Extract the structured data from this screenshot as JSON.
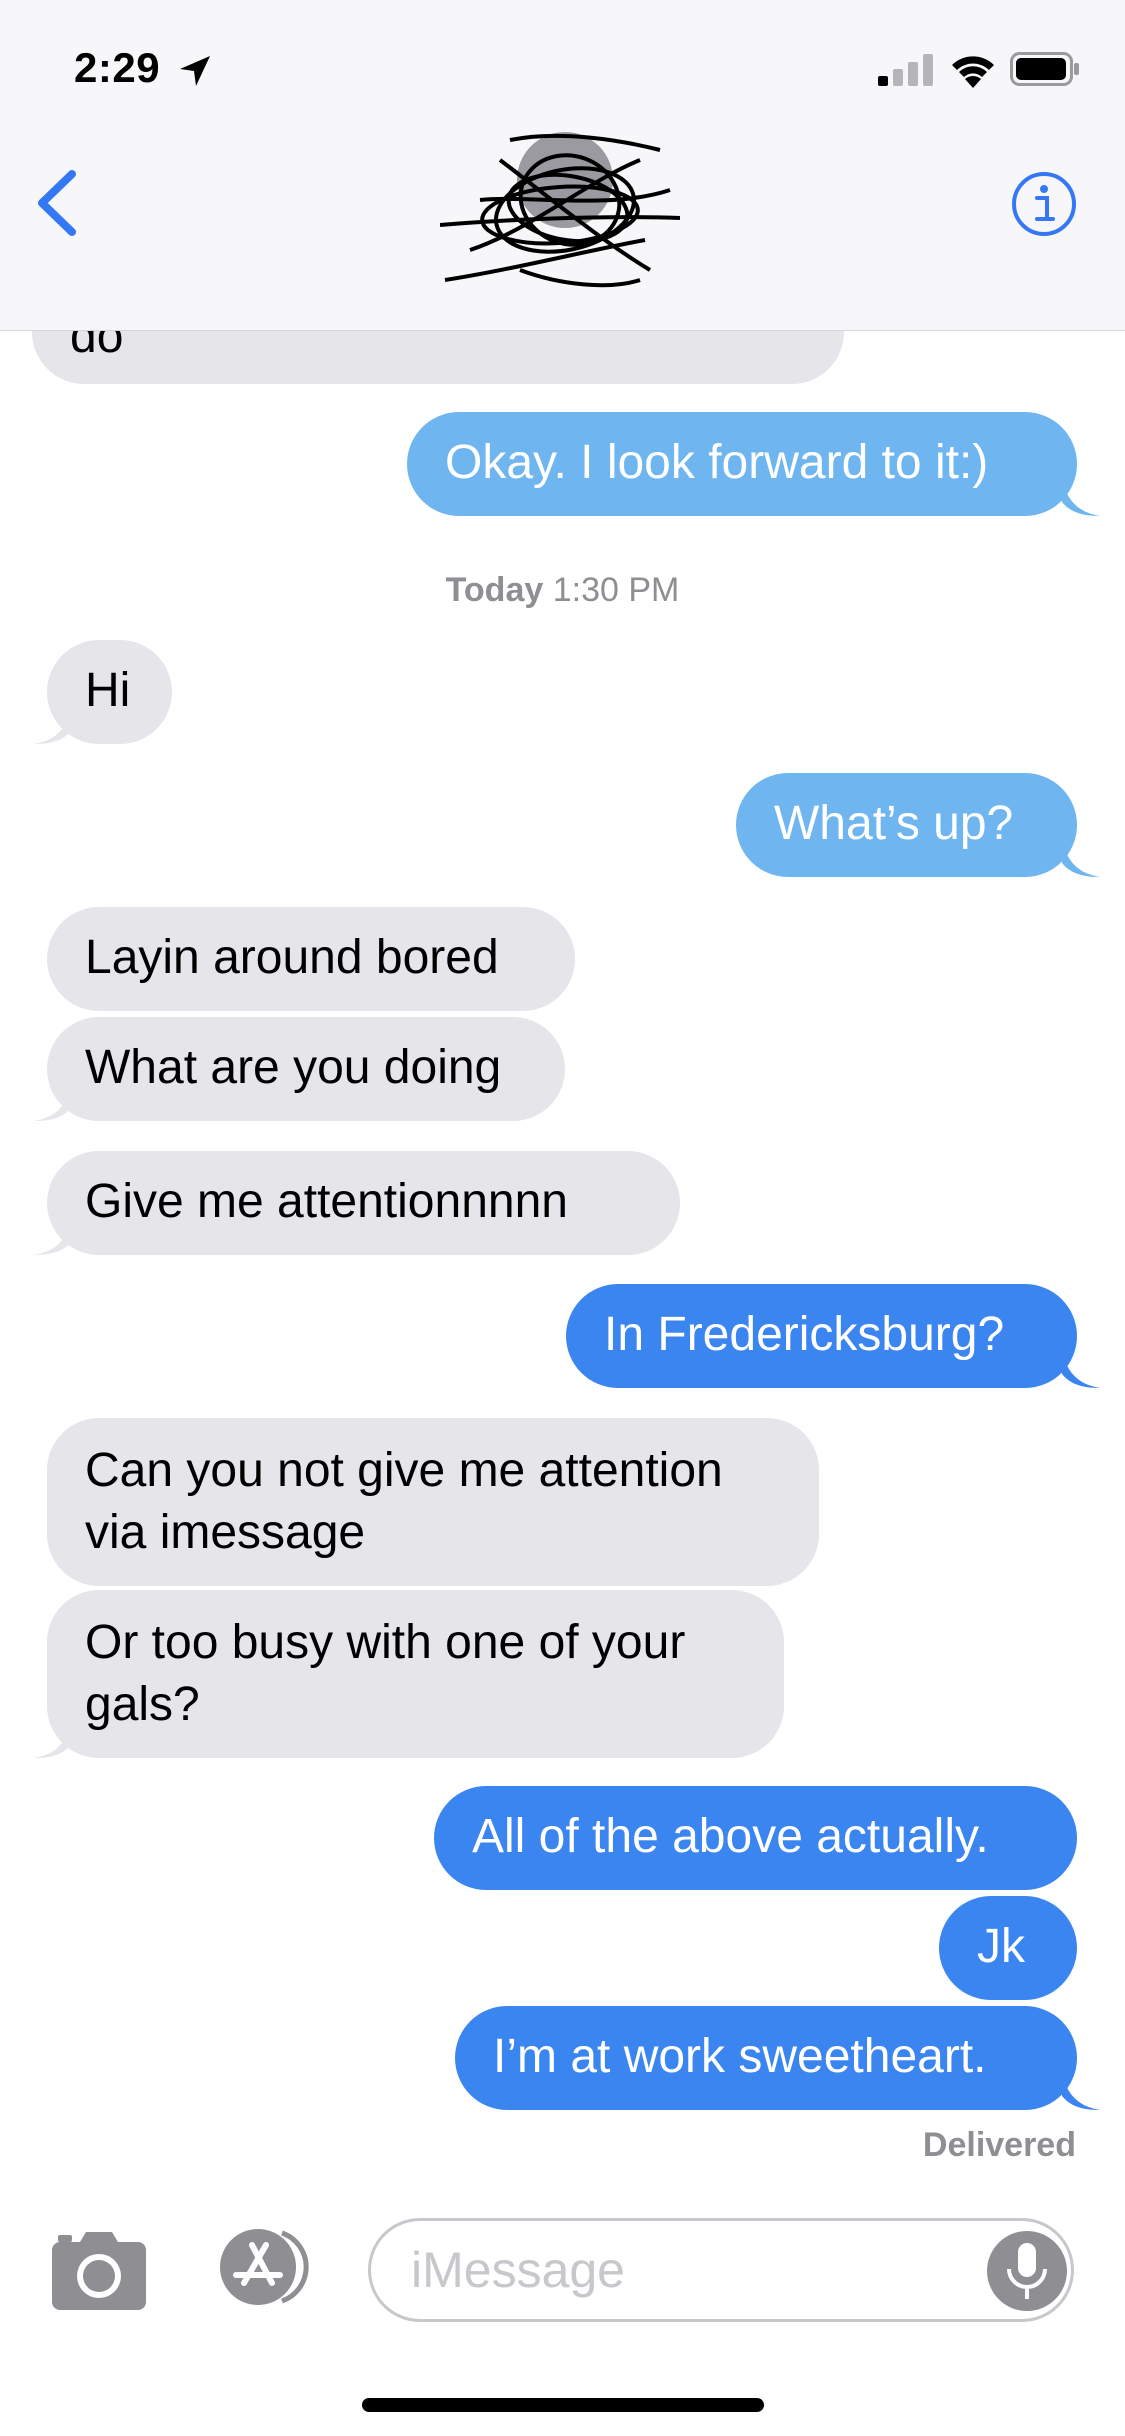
{
  "status_bar": {
    "time": "2:29"
  },
  "input": {
    "placeholder": "iMessage"
  },
  "timestamp": {
    "day": "Today",
    "time": "1:30 PM"
  },
  "delivered": "Delivered",
  "messages": [
    {
      "text": "do"
    },
    {
      "text": "Okay. I look forward to it:)"
    },
    {
      "text": "Hi"
    },
    {
      "text": "What’s up?"
    },
    {
      "text": "Layin around bored"
    },
    {
      "text": "What are you doing"
    },
    {
      "text": "Give me attentionnnnn"
    },
    {
      "text": "In Fredericksburg?"
    },
    {
      "text": "Can you not give me attention"
    },
    {
      "text": "via imessage"
    },
    {
      "text": "Or too busy with one of your"
    },
    {
      "text": "gals?"
    },
    {
      "text": "All of the above actually."
    },
    {
      "text": "Jk"
    },
    {
      "text": "I’m at work sweetheart."
    }
  ],
  "colors": {
    "incoming_bubble": "#e5e5ea",
    "outgoing_sms_like": "#6fb5f0",
    "outgoing_imessage": "#3a85ef",
    "ios_blue": "#3478f6"
  },
  "icons": [
    "location-arrow-icon",
    "signal-icon",
    "wifi-icon",
    "battery-icon",
    "back-chevron-icon",
    "info-icon",
    "camera-icon",
    "app-store-icon",
    "microphone-icon"
  ]
}
